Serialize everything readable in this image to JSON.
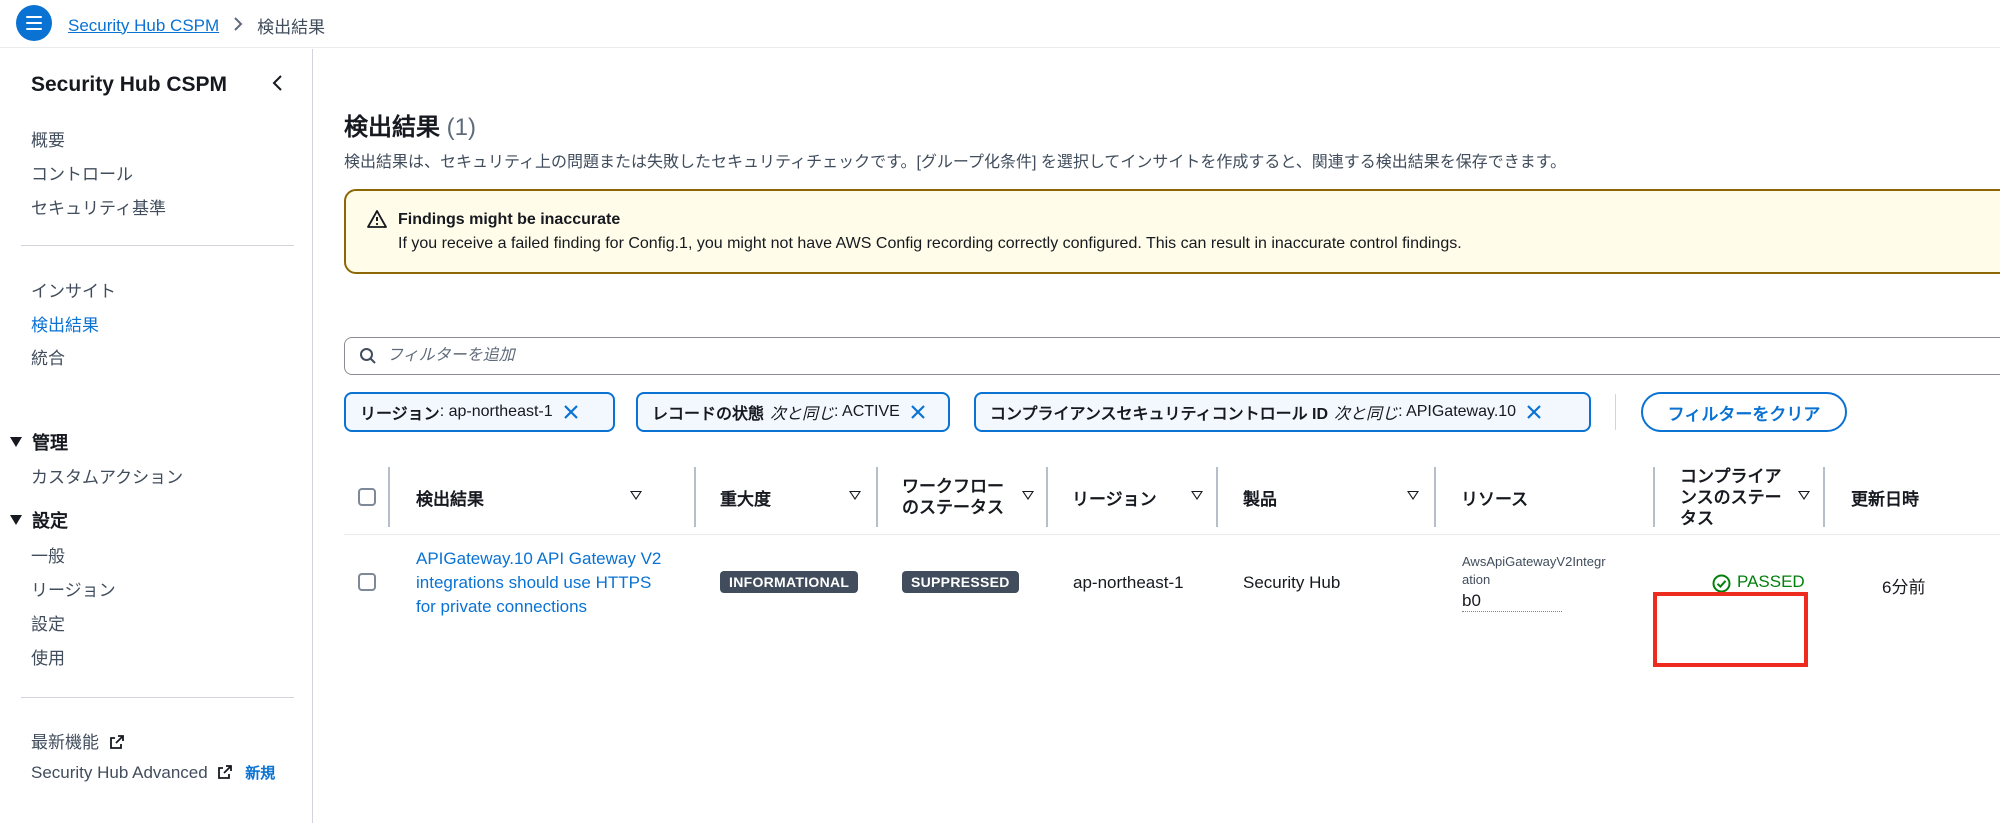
{
  "topbar": {
    "menu_icon": "hamburger-menu-icon",
    "breadcrumb": {
      "root": "Security Hub CSPM",
      "current": "検出結果"
    }
  },
  "sidebar": {
    "title": "Security Hub CSPM",
    "group1": [
      "概要",
      "コントロール",
      "セキュリティ基準"
    ],
    "group2": [
      {
        "label": "インサイト",
        "active": false
      },
      {
        "label": "検出結果",
        "active": true
      },
      {
        "label": "統合",
        "active": false
      }
    ],
    "manage": {
      "heading": "管理",
      "items": [
        "カスタムアクション"
      ]
    },
    "settings": {
      "heading": "設定",
      "items": [
        "一般",
        "リージョン",
        "設定",
        "使用"
      ]
    },
    "footer": {
      "whats_new": "最新機能",
      "advanced": "Security Hub Advanced",
      "new_badge": "新規"
    }
  },
  "header": {
    "title": "検出結果",
    "count": "(1)",
    "description": "検出結果は、セキュリティ上の問題または失敗したセキュリティチェックです。[グループ化条件] を選択してインサイトを作成すると、関連する検出結果を保存できます。"
  },
  "alert": {
    "title": "Findings might be inaccurate",
    "body": "If you receive a failed finding for Config.1, you might not have AWS Config recording correctly configured. This can result in inaccurate control findings.",
    "icon": "warning-icon",
    "color": "#8d6605"
  },
  "filter": {
    "placeholder": "フィルターを追加",
    "tokens": [
      {
        "key": "リージョン",
        "op": "",
        "value": ": ap-northeast-1"
      },
      {
        "key": "レコードの状態",
        "op": "次と同じ",
        "value": ": ACTIVE"
      },
      {
        "key": "コンプライアンスセキュリティコントロール ID",
        "op": "次と同じ",
        "value": ": APIGateway.10"
      }
    ],
    "clear_label": "フィルターをクリア"
  },
  "table": {
    "columns": {
      "finding": "検出結果",
      "severity": "重大度",
      "workflow_1": "ワークフロー",
      "workflow_2": "のステータス",
      "region": "リージョン",
      "product": "製品",
      "resource": "リソース",
      "compliance_1": "コンプライア",
      "compliance_2": "ンスのステー",
      "compliance_3": "タス",
      "updated": "更新日時"
    },
    "rows": [
      {
        "title_1": "APIGateway.10 API Gateway V2",
        "title_2": "integrations should use HTTPS",
        "title_3": "for private connections",
        "severity": "INFORMATIONAL",
        "workflow": "SUPPRESSED",
        "region": "ap-northeast-1",
        "product": "Security Hub",
        "resource_type_1": "AwsApiGatewayV2Integr",
        "resource_type_2": "ation",
        "resource_id": "b0",
        "compliance": "PASSED",
        "updated": "6分前"
      }
    ]
  },
  "colors": {
    "accent": "#0972d3",
    "passed": "#037f0c",
    "highlight": "#ee2b1f"
  }
}
